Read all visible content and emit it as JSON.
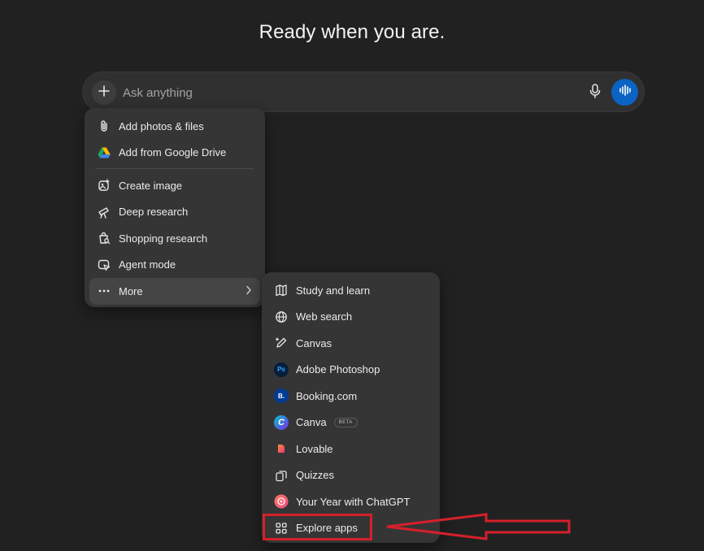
{
  "headline": "Ready when you are.",
  "composer": {
    "placeholder": "Ask anything",
    "add_icon": "plus-icon",
    "mic_icon": "microphone-icon",
    "voice_icon": "voice-waveform-icon",
    "voice_color": "#0b63c4"
  },
  "menu": {
    "items": [
      {
        "label": "Add photos & files",
        "icon": "paperclip-icon"
      },
      {
        "label": "Add from Google Drive",
        "icon": "google-drive-icon"
      },
      {
        "label": "Create image",
        "icon": "image-create-icon"
      },
      {
        "label": "Deep research",
        "icon": "telescope-icon"
      },
      {
        "label": "Shopping research",
        "icon": "shopping-search-icon"
      },
      {
        "label": "Agent mode",
        "icon": "agent-cursor-icon"
      },
      {
        "label": "More",
        "icon": "more-dots-icon",
        "submenu_icon": "chevron-right-icon"
      }
    ]
  },
  "submenu": {
    "items": [
      {
        "label": "Study and learn",
        "icon": "book-icon"
      },
      {
        "label": "Web search",
        "icon": "globe-icon"
      },
      {
        "label": "Canvas",
        "icon": "pencil-icon"
      },
      {
        "label": "Adobe Photoshop",
        "icon": "photoshop-icon",
        "badge_text": "Ps"
      },
      {
        "label": "Booking.com",
        "icon": "booking-icon",
        "badge_text": "B."
      },
      {
        "label": "Canva",
        "icon": "canva-icon",
        "badge_text": "C",
        "tag": "BETA"
      },
      {
        "label": "Lovable",
        "icon": "lovable-heart-icon"
      },
      {
        "label": "Quizzes",
        "icon": "quiz-cards-icon"
      },
      {
        "label": "Your Year with ChatGPT",
        "icon": "year-review-icon"
      },
      {
        "label": "Explore apps",
        "icon": "apps-grid-icon"
      }
    ]
  },
  "annotation": {
    "highlight_color": "#d4202a",
    "target": "Explore apps"
  }
}
